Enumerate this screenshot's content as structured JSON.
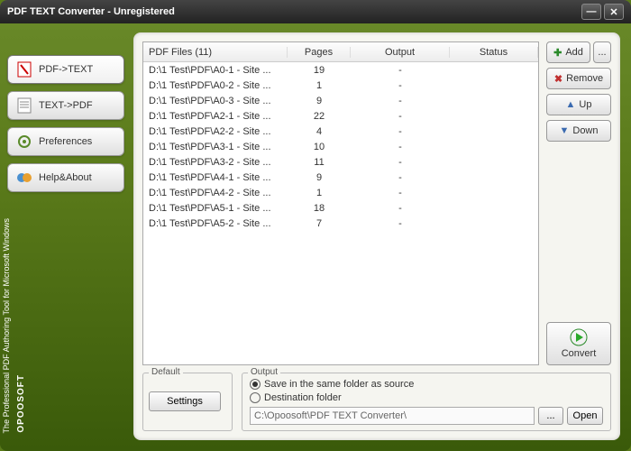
{
  "titlebar": {
    "title": "PDF TEXT Converter - Unregistered"
  },
  "sidebar": {
    "items": [
      {
        "label": "PDF->TEXT"
      },
      {
        "label": "TEXT->PDF"
      },
      {
        "label": "Preferences"
      },
      {
        "label": "Help&About"
      }
    ]
  },
  "brand": "OPOOSOFT",
  "tagline": "The Professional PDF Authoring Tool\nfor Microsoft Windows",
  "table": {
    "header": {
      "files": "PDF Files (11)",
      "pages": "Pages",
      "output": "Output",
      "status": "Status"
    },
    "rows": [
      {
        "file": "D:\\1 Test\\PDF\\A0-1 - Site ...",
        "pages": "19",
        "output": "-",
        "status": ""
      },
      {
        "file": "D:\\1 Test\\PDF\\A0-2 - Site ...",
        "pages": "1",
        "output": "-",
        "status": ""
      },
      {
        "file": "D:\\1 Test\\PDF\\A0-3 - Site ...",
        "pages": "9",
        "output": "-",
        "status": ""
      },
      {
        "file": "D:\\1 Test\\PDF\\A2-1 - Site ...",
        "pages": "22",
        "output": "-",
        "status": ""
      },
      {
        "file": "D:\\1 Test\\PDF\\A2-2 - Site ...",
        "pages": "4",
        "output": "-",
        "status": ""
      },
      {
        "file": "D:\\1 Test\\PDF\\A3-1 - Site ...",
        "pages": "10",
        "output": "-",
        "status": ""
      },
      {
        "file": "D:\\1 Test\\PDF\\A3-2 - Site ...",
        "pages": "11",
        "output": "-",
        "status": ""
      },
      {
        "file": "D:\\1 Test\\PDF\\A4-1 - Site ...",
        "pages": "9",
        "output": "-",
        "status": ""
      },
      {
        "file": "D:\\1 Test\\PDF\\A4-2 - Site ...",
        "pages": "1",
        "output": "-",
        "status": ""
      },
      {
        "file": "D:\\1 Test\\PDF\\A5-1 - Site ...",
        "pages": "18",
        "output": "-",
        "status": ""
      },
      {
        "file": "D:\\1 Test\\PDF\\A5-2 - Site ...",
        "pages": "7",
        "output": "-",
        "status": ""
      }
    ]
  },
  "buttons": {
    "add": "Add",
    "browse": "...",
    "remove": "Remove",
    "up": "Up",
    "down": "Down",
    "convert": "Convert"
  },
  "default_box": {
    "title": "Default",
    "settings": "Settings"
  },
  "output_box": {
    "title": "Output",
    "radio_same": "Save in the same folder as source",
    "radio_dest": "Destination folder",
    "path": "C:\\Opoosoft\\PDF TEXT Converter\\",
    "browse": "...",
    "open": "Open"
  }
}
